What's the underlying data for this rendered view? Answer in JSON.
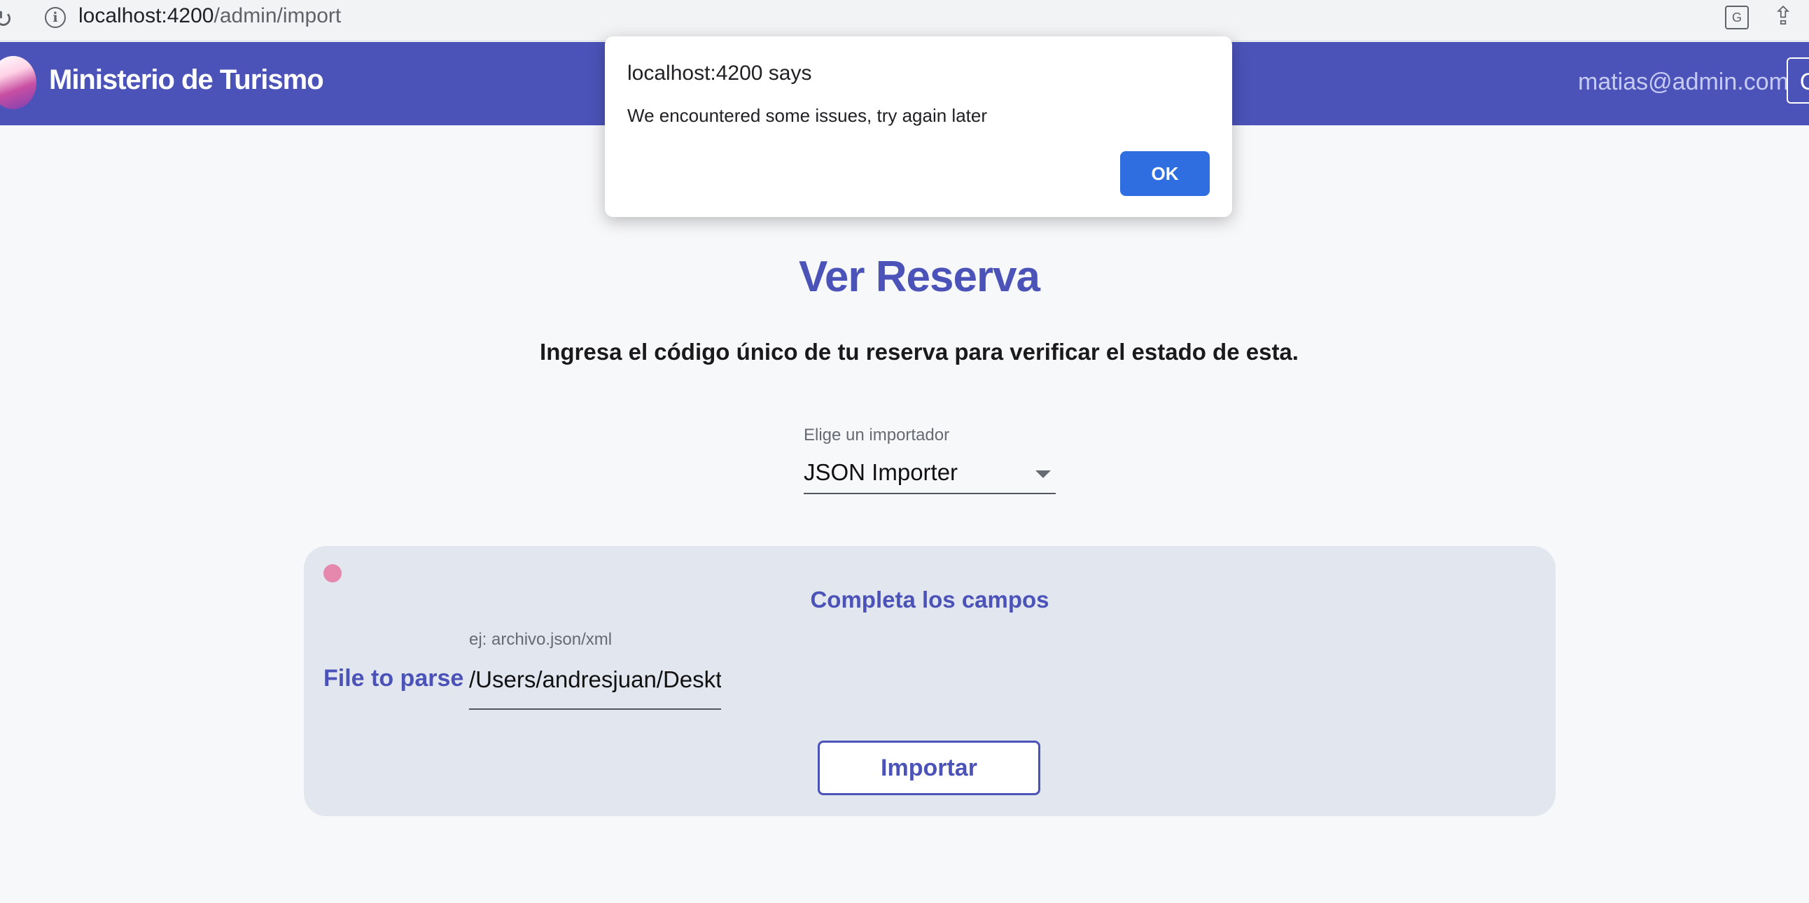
{
  "browser": {
    "url_host": "localhost:4200",
    "url_path": "/admin/import",
    "reload_icon": "↻",
    "info_icon": "i",
    "translate_icon": "G",
    "share_icon": "⇪"
  },
  "header": {
    "app_title": "Ministerio de Turismo",
    "user_email": "matias@admin.com",
    "button_label": "C"
  },
  "main": {
    "title": "Ver Reserva",
    "subtitle": "Ingresa el código único de tu reserva para verificar el estado de esta.",
    "importer_select": {
      "label": "Elige un importador",
      "value": "JSON Importer"
    }
  },
  "card": {
    "title": "Completa los campos",
    "file_label": "File to parse",
    "file_placeholder": "ej: archivo.json/xml",
    "file_value": "/Users/andresjuan/Desktop",
    "import_button": "Importar"
  },
  "alert": {
    "title": "localhost:4200 says",
    "message": "We encountered some issues, try again later",
    "ok_label": "OK"
  },
  "colors": {
    "primary": "#4b53b8",
    "dialog_button": "#2f6ee0",
    "status_dot": "#e688ad"
  }
}
